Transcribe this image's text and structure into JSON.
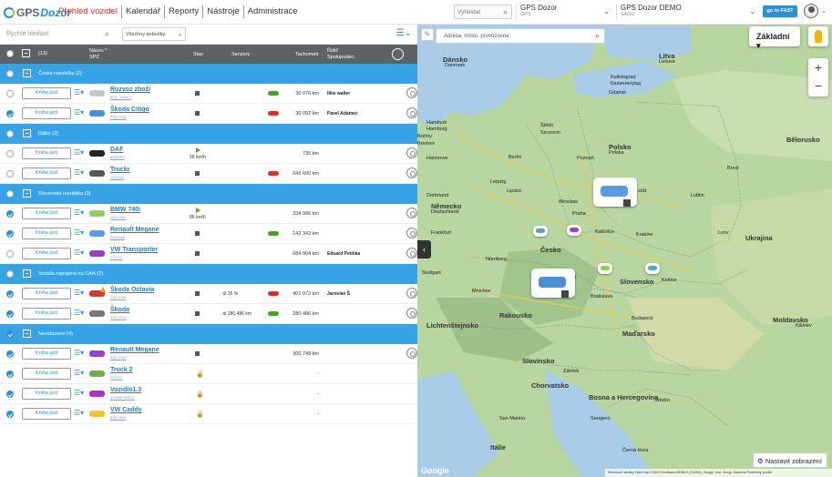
{
  "app": {
    "logo_gps": "GPS",
    "logo_dozor": "Dozor"
  },
  "nav": [
    "Přehled vozidel",
    "Kalendář",
    "Reporty",
    "Nástroje",
    "Administrace"
  ],
  "top_search": {
    "placeholder": "Vyhledat"
  },
  "company_select": {
    "title": "GPS Dozor",
    "sub": "GPS"
  },
  "account_select": {
    "title": "GPS Dozor DEMO",
    "sub": "SAGU"
  },
  "fast_button": "go to FAST",
  "filter": {
    "placeholder": "Rychlé hledání",
    "branches": "Všechny pobočky"
  },
  "table_header": {
    "count": "(13)",
    "name": "Název",
    "spz": "SPZ",
    "stav": "Stav",
    "sensors": "Senzory",
    "tacho": "Tachometr",
    "driver_1": "Řidič",
    "driver_2": "Spolujezdec"
  },
  "book_label": "Kniha jízd",
  "groups": [
    {
      "title": "Česká republika (2)",
      "checked": false
    },
    {
      "title": "Dálky (2)",
      "checked": false
    },
    {
      "title": "Slovenská republika (3)",
      "checked": false
    },
    {
      "title": "Vozidla napojená na CAN (2)",
      "checked": false
    },
    {
      "title": "Nezařazeno (4)",
      "checked": true
    }
  ],
  "vehicles": [
    {
      "name": "Rozvoz zboží",
      "spz": "8E5 - zboží 2",
      "tacho": "30 076 km",
      "driver": "Ilkw walter",
      "state": "stop",
      "checked": false,
      "color": "#c8c8c8",
      "key": "#4a9f2a"
    },
    {
      "name": "Škoda Citigo",
      "spz": "2A5 2230",
      "tacho": "30 092 km",
      "driver": "Pavel Adamec",
      "state": "stop",
      "checked": true,
      "color": "#4a90d9",
      "key": "#d9302a"
    },
    {
      "name": "DAF",
      "spz": "8989095",
      "tacho": "735 km",
      "driver": "",
      "state": "play",
      "speed": "96 km/h",
      "checked": false,
      "color": "#222",
      "key": ""
    },
    {
      "name": "Truckr",
      "spz": "1151515",
      "tacho": "645 690 km",
      "driver": "",
      "state": "stop",
      "checked": false,
      "color": "#555",
      "key": "#d9302a"
    },
    {
      "name": "BMW 740i",
      "spz": "4A5 1247",
      "tacho": "334 996 km",
      "driver": "",
      "state": "play",
      "speed": "86 km/h",
      "checked": true,
      "color": "#8cd05a",
      "key": ""
    },
    {
      "name": "Renault Megane",
      "spz": "AAAAAA",
      "tacho": "142 342 km",
      "driver": "",
      "state": "stop",
      "checked": true,
      "color": "#5b9be0",
      "key": "#4a9f2a"
    },
    {
      "name": "VW Transporter",
      "spz": "YYYYY",
      "tacho": "684 904 km",
      "driver": "Eduard Petiška",
      "state": "stop",
      "checked": false,
      "color": "#9b3fd1",
      "key": ""
    },
    {
      "name": "Škoda Octavia",
      "spz": "7A9 4099",
      "tacho": "401 973 km",
      "driver": "Jaroslav Š",
      "state": "stop",
      "checked": true,
      "color": "#e0352a",
      "key": "#d9302a",
      "sensor": "35 %"
    },
    {
      "name": "Škoda",
      "spz": "6AE 1078",
      "tacho": "280 486 km",
      "driver": "",
      "state": "stop",
      "checked": true,
      "color": "#777",
      "key": "#4a9f2a",
      "sensor": "280 486 km"
    },
    {
      "name": "Renault Megane",
      "spz": "8A0 7015",
      "tacho": "300 749 km",
      "driver": "",
      "state": "stop",
      "checked": true,
      "color": "#9b3fd1",
      "key": ""
    },
    {
      "name": "Truck 2",
      "spz": "222222",
      "tacho": "-",
      "driver": "",
      "state": "lock",
      "checked": true,
      "color": "#6db33f",
      "key": ""
    },
    {
      "name": "Vozidlo1.3",
      "spz": "123456789012",
      "tacho": "-",
      "driver": "",
      "state": "lock",
      "checked": true,
      "color": "#b030c0",
      "key": ""
    },
    {
      "name": "VW Caddy",
      "spz": "3A5 2840",
      "tacho": "-",
      "driver": "",
      "state": "lock",
      "checked": true,
      "color": "#f5c518",
      "key": ""
    }
  ],
  "map": {
    "search_placeholder": "Adresa, místo, provozovna",
    "type": "Základní",
    "set_view": "Nastavit zobrazení",
    "google": "Google",
    "attribution": "Klávesové zkratky   Data map ©2023 GeoBasis-DE/BKG (©2009), Google, Inst. Geogr. Nacional   Podmínky použití",
    "labels": [
      "Dánsko",
      "Danmark",
      "Litva",
      "Lietuva",
      "Kaliningrad",
      "Калининград",
      "Gdańsk",
      "Hamburk",
      "Hamburg",
      "Štětín",
      "Szczecin",
      "Brémy",
      "Bremen",
      "Hannover",
      "Berlín",
      "Poznaň",
      "Polsko",
      "Polska",
      "Bělorusko",
      "Brest",
      "Leipzig",
      "Lipsko",
      "Dortmund",
      "Německo",
      "Deutschland",
      "Praha",
      "Wrocław",
      "Łódź",
      "Lublin",
      "Frankfurt",
      "Česko",
      "Katovice",
      "Kraków",
      "Lvov",
      "Ukrajina",
      "Nürnberg",
      "Stuttgart",
      "Mnichov",
      "Vídeň",
      "Bratislava",
      "Slovensko",
      "Košice",
      "Rakousko",
      "Maďarsko",
      "Budapest",
      "Lichtenštejnsko",
      "Slovinsko",
      "Záhřeb",
      "Chorvatsko",
      "Bosna a Hercegovina",
      "San Marino",
      "Srbsko",
      "Sarajevo",
      "Itálie",
      "Černá Hora",
      "Moldavsko",
      "Kišiněv"
    ]
  },
  "colors": {
    "accent": "#36a3e6",
    "header": "#5e6266",
    "brand_red": "#e0302a"
  }
}
